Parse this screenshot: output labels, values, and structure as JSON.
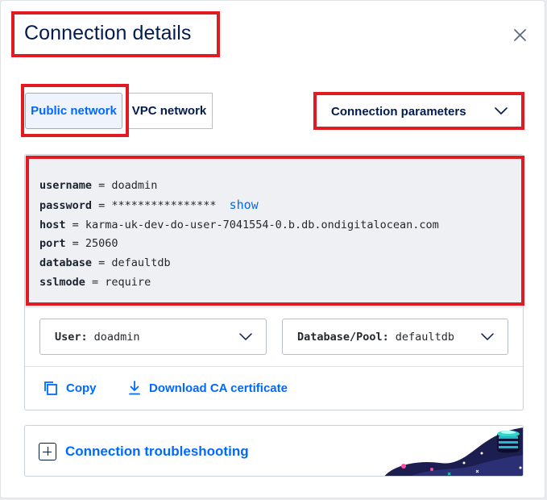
{
  "dialog": {
    "title": "Connection details",
    "close_icon": "close-icon"
  },
  "tabs": [
    {
      "label": "Public network",
      "active": true
    },
    {
      "label": "VPC network",
      "active": false
    }
  ],
  "params_dropdown": {
    "label": "Connection parameters",
    "icon": "chevron-down-icon"
  },
  "connection": {
    "username": {
      "key": "username",
      "value": "doadmin"
    },
    "password": {
      "key": "password",
      "value": "****************",
      "show_label": "show"
    },
    "host": {
      "key": "host",
      "value": "karma-uk-dev-do-user-7041554-0.b.db.ondigitalocean.com"
    },
    "port": {
      "key": "port",
      "value": "25060"
    },
    "database": {
      "key": "database",
      "value": "defaultdb"
    },
    "sslmode": {
      "key": "sslmode",
      "value": "require"
    }
  },
  "selects": {
    "user": {
      "label": "User:",
      "value": "doadmin"
    },
    "database": {
      "label": "Database/Pool:",
      "value": "defaultdb"
    }
  },
  "actions": {
    "copy": {
      "label": "Copy",
      "icon": "copy-icon"
    },
    "download": {
      "label": "Download CA certificate",
      "icon": "download-icon"
    }
  },
  "troubleshooting": {
    "label": "Connection troubleshooting",
    "icon": "plus-box-icon"
  },
  "colors": {
    "accent": "#0069ff",
    "highlight": "#e01b24",
    "text": "#031b4e"
  }
}
